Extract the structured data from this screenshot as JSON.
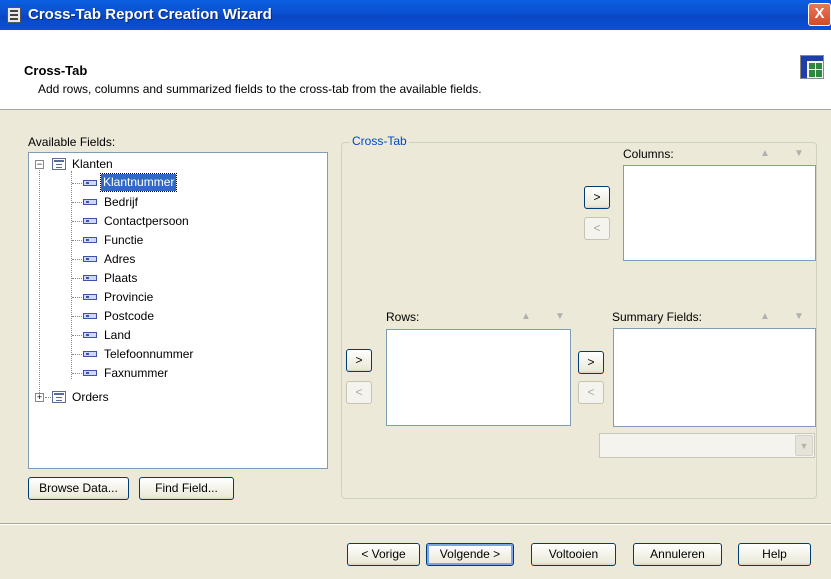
{
  "window": {
    "title": "Cross-Tab Report Creation Wizard",
    "close_label": "X"
  },
  "header": {
    "title": "Cross-Tab",
    "description": "Add rows, columns and summarized fields to the cross-tab from the available fields."
  },
  "available": {
    "label": "Available Fields:",
    "tables": [
      {
        "name": "Klanten",
        "expanded": true,
        "fields": [
          "Klantnummer",
          "Bedrijf",
          "Contactpersoon",
          "Functie",
          "Adres",
          "Plaats",
          "Provincie",
          "Postcode",
          "Land",
          "Telefoonnummer",
          "Faxnummer"
        ]
      },
      {
        "name": "Orders",
        "expanded": false,
        "fields": []
      }
    ],
    "selected_field": "Klantnummer",
    "browse_label": "Browse Data...",
    "find_label": "Find Field..."
  },
  "crosstab": {
    "group_label": "Cross-Tab",
    "columns_label": "Columns:",
    "rows_label": "Rows:",
    "summary_label": "Summary Fields:",
    "add_label": ">",
    "remove_label": "<",
    "up_label": "▲",
    "down_label": "▼"
  },
  "footer": {
    "back_label": "< Vorige",
    "next_label": "Volgende >",
    "finish_label": "Voltooien",
    "cancel_label": "Annuleren",
    "help_label": "Help"
  }
}
